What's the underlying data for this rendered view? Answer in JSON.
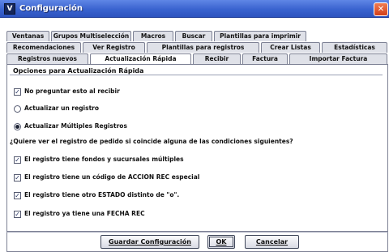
{
  "window": {
    "title": "Configuración",
    "app_icon_glyph": "V",
    "close_glyph": "✕",
    "colors": {
      "titlebar": "#3a63cf",
      "close": "#d2401a"
    }
  },
  "tabs": {
    "row1": [
      "Ventanas",
      "Grupos Multiselección",
      "Macros",
      "Buscar",
      "Plantillas para imprimir"
    ],
    "row2": [
      "Recomendaciones",
      "Ver Registro",
      "Plantillas para registros",
      "Crear Listas",
      "Estadísticas"
    ],
    "row3": [
      "Registros nuevos",
      "Actualización Rápida",
      "Recibir",
      "Factura",
      "Importar Factura"
    ],
    "active": "Actualización Rápida"
  },
  "group": {
    "title": "Opciones para Actualización Rápida",
    "options": [
      {
        "type": "checkbox",
        "label": "No preguntar esto al recibir",
        "checked": true
      },
      {
        "type": "radio",
        "label": "Actualizar un registro",
        "selected": false
      },
      {
        "type": "radio",
        "label": "Actualizar Múltiples Registros",
        "selected": true
      }
    ]
  },
  "question": "¿Quiere ver el registro de pedido si coincide alguna de las condiciones siguientes?",
  "conditions": [
    {
      "label": "El registro tiene fondos y sucursales múltiples",
      "checked": true
    },
    {
      "label": "El registro tiene un código de ACCION REC especial",
      "checked": true
    },
    {
      "label": "El registro tiene otro ESTADO distinto de \"o\".",
      "checked": true
    },
    {
      "label": "El registro ya tiene una FECHA REC",
      "checked": true
    }
  ],
  "buttons": {
    "save": "Guardar Configuración",
    "ok": "OK",
    "cancel": "Cancelar"
  },
  "check_glyph": "✓"
}
